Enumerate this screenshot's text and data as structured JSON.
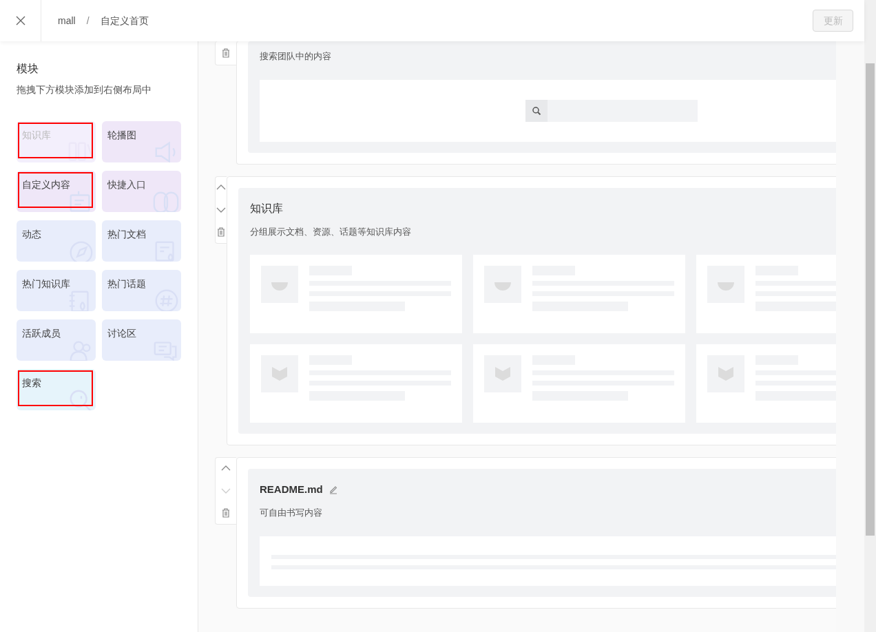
{
  "header": {
    "breadcrumb": [
      {
        "label": "mall"
      },
      {
        "label": "自定义首页"
      }
    ],
    "breadcrumb_separator": "/",
    "update_button": {
      "label": "更新",
      "disabled": true
    }
  },
  "sidebar": {
    "title": "模块",
    "hint": "拖拽下方模块添加到右侧布局中",
    "modules": [
      {
        "label": "知识库",
        "disabled": true,
        "marked": true,
        "color": "#f3effc"
      },
      {
        "label": "轮播图",
        "disabled": false,
        "marked": false,
        "color": "#efe7f8"
      },
      {
        "label": "自定义内容",
        "disabled": false,
        "marked": true,
        "color": "#efe7f8"
      },
      {
        "label": "快捷入口",
        "disabled": false,
        "marked": false,
        "color": "#efe7f8"
      },
      {
        "label": "动态",
        "disabled": false,
        "marked": false,
        "color": "#e8edfb"
      },
      {
        "label": "热门文档",
        "disabled": false,
        "marked": false,
        "color": "#e8edfb"
      },
      {
        "label": "热门知识库",
        "disabled": false,
        "marked": false,
        "color": "#e8edfb"
      },
      {
        "label": "热门话题",
        "disabled": false,
        "marked": false,
        "color": "#e8edfb"
      },
      {
        "label": "活跃成员",
        "disabled": false,
        "marked": false,
        "color": "#e8edfb"
      },
      {
        "label": "讨论区",
        "disabled": false,
        "marked": false,
        "color": "#e8edfb"
      },
      {
        "label": "搜索",
        "disabled": false,
        "marked": true,
        "color": "#e6f4fb"
      }
    ]
  },
  "sections": [
    {
      "kind": "search",
      "description": "搜索团队中的内容",
      "controls": [
        {
          "kind": "delete",
          "disabled": false
        }
      ]
    },
    {
      "kind": "repos",
      "title": "知识库",
      "description": "分组展示文档、资源、话题等知识库内容",
      "controls": [
        {
          "kind": "up",
          "disabled": false
        },
        {
          "kind": "down",
          "disabled": false
        },
        {
          "kind": "delete",
          "disabled": false
        }
      ]
    },
    {
      "kind": "readme",
      "title": "README.md",
      "editable": true,
      "description": "可自由书写内容",
      "controls": [
        {
          "kind": "up",
          "disabled": false
        },
        {
          "kind": "down",
          "disabled": true
        },
        {
          "kind": "delete",
          "disabled": false
        }
      ]
    }
  ]
}
